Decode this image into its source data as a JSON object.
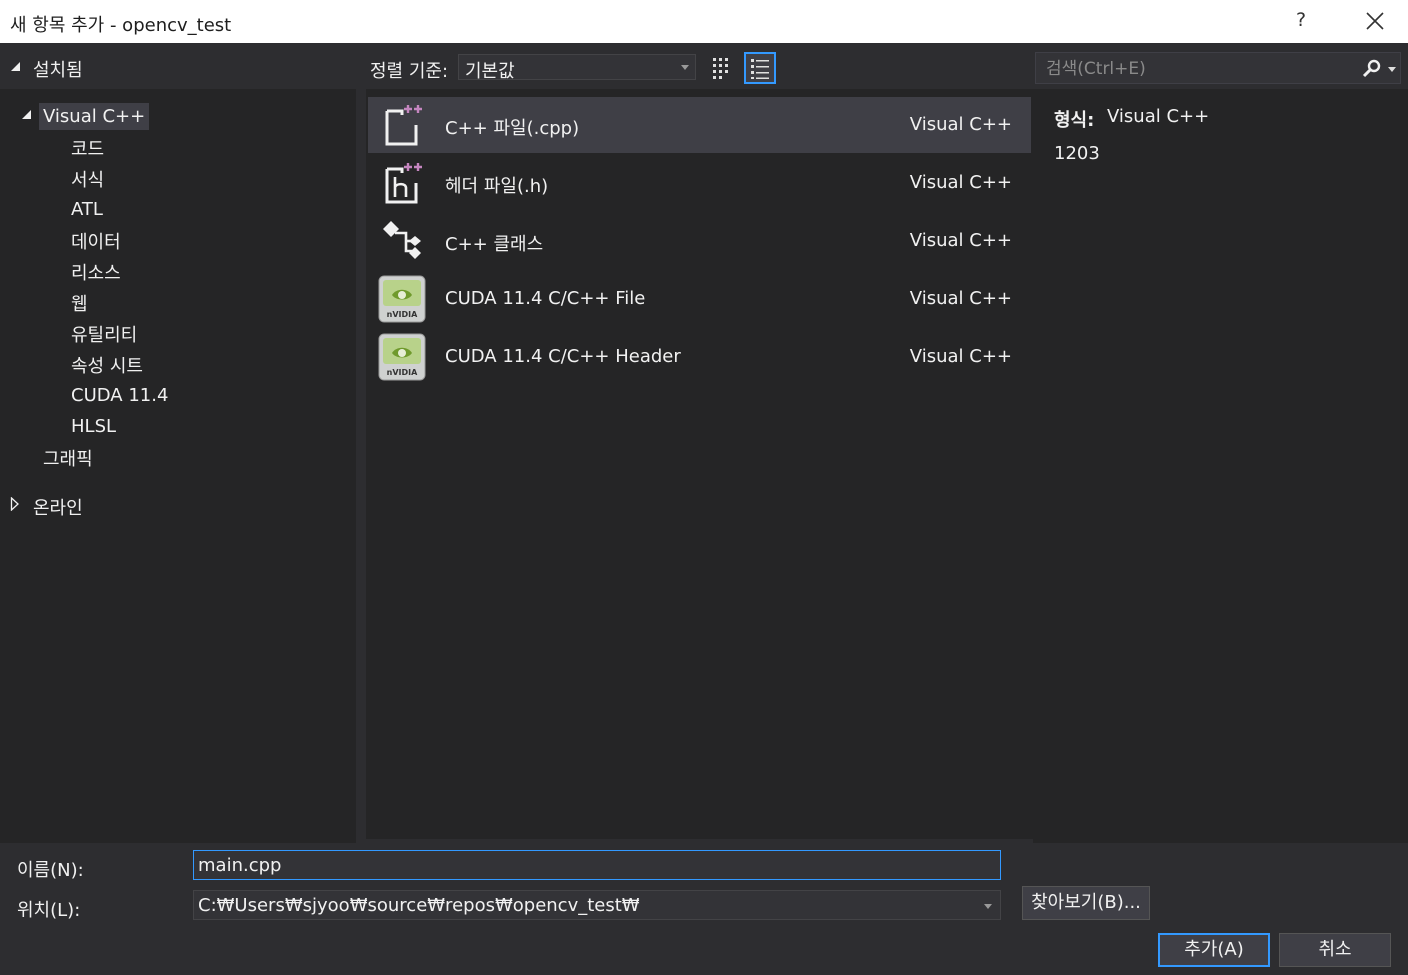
{
  "window": {
    "title": "새 항목 추가 - opencv_test",
    "help_label": "?"
  },
  "tree": {
    "installed_label": "설치됨",
    "items": [
      {
        "label": "Visual C++",
        "selected": true
      },
      {
        "label": "코드"
      },
      {
        "label": "서식"
      },
      {
        "label": "ATL"
      },
      {
        "label": "데이터"
      },
      {
        "label": "리소스"
      },
      {
        "label": "웹"
      },
      {
        "label": "유틸리티"
      },
      {
        "label": "속성 시트"
      },
      {
        "label": "CUDA 11.4"
      },
      {
        "label": "HLSL"
      },
      {
        "label": "그래픽"
      }
    ],
    "online_label": "온라인"
  },
  "toolbar": {
    "sort_label": "정렬 기준:",
    "sort_value": "기본값"
  },
  "templates": [
    {
      "name": "C++ 파일(.cpp)",
      "lang": "Visual C++",
      "icon": "cpp-file-icon",
      "selected": true
    },
    {
      "name": "헤더 파일(.h)",
      "lang": "Visual C++",
      "icon": "header-file-icon"
    },
    {
      "name": "C++ 클래스",
      "lang": "Visual C++",
      "icon": "cpp-class-icon"
    },
    {
      "name": "CUDA 11.4 C/C++ File",
      "lang": "Visual C++",
      "icon": "nvidia-icon"
    },
    {
      "name": "CUDA 11.4 C/C++ Header",
      "lang": "Visual C++",
      "icon": "nvidia-icon"
    }
  ],
  "search": {
    "placeholder": "검색(Ctrl+E)"
  },
  "details": {
    "type_label": "형식:",
    "type_value": "Visual C++",
    "description": "1203"
  },
  "form": {
    "name_label": "이름(N):",
    "name_value": "main.cpp",
    "location_label": "위치(L):",
    "location_value": "C:₩Users₩sjyoo₩source₩repos₩opencv_test₩",
    "browse_label": "찾아보기(B)...",
    "add_label": "추가(A)",
    "cancel_label": "취소"
  },
  "colors": {
    "accent": "#3399ff",
    "background": "#2d2d30",
    "panel": "#252526",
    "selection": "#3f3f46"
  }
}
